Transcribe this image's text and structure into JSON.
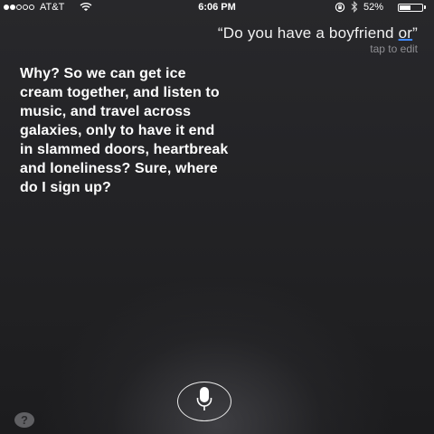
{
  "status_bar": {
    "carrier": "AT&T",
    "time": "6:06 PM",
    "battery_percent": "52%",
    "battery_level": 0.52,
    "signal_bars_filled": 2,
    "signal_bars_total": 5,
    "icons": [
      "wifi-icon",
      "rotation-lock-icon",
      "bluetooth-icon",
      "battery-icon"
    ]
  },
  "siri": {
    "query_main": "“Do you have a boyfriend ",
    "query_underlined": "or",
    "query_end": "”",
    "tap_to_edit": "tap to edit",
    "response": "Why? So we can get ice\ncream together, and listen to\nmusic, and travel across\ngalaxies, only to have it end\nin slammed doors, heartbreak\nand loneliness? Sure, where\ndo I sign up?",
    "mic_icon": "microphone-icon",
    "help_label": "?"
  },
  "colors": {
    "background": "#242427",
    "text": "#ffffff",
    "secondary_text": "#8e8e93",
    "accent_underline": "#3f88ff"
  }
}
